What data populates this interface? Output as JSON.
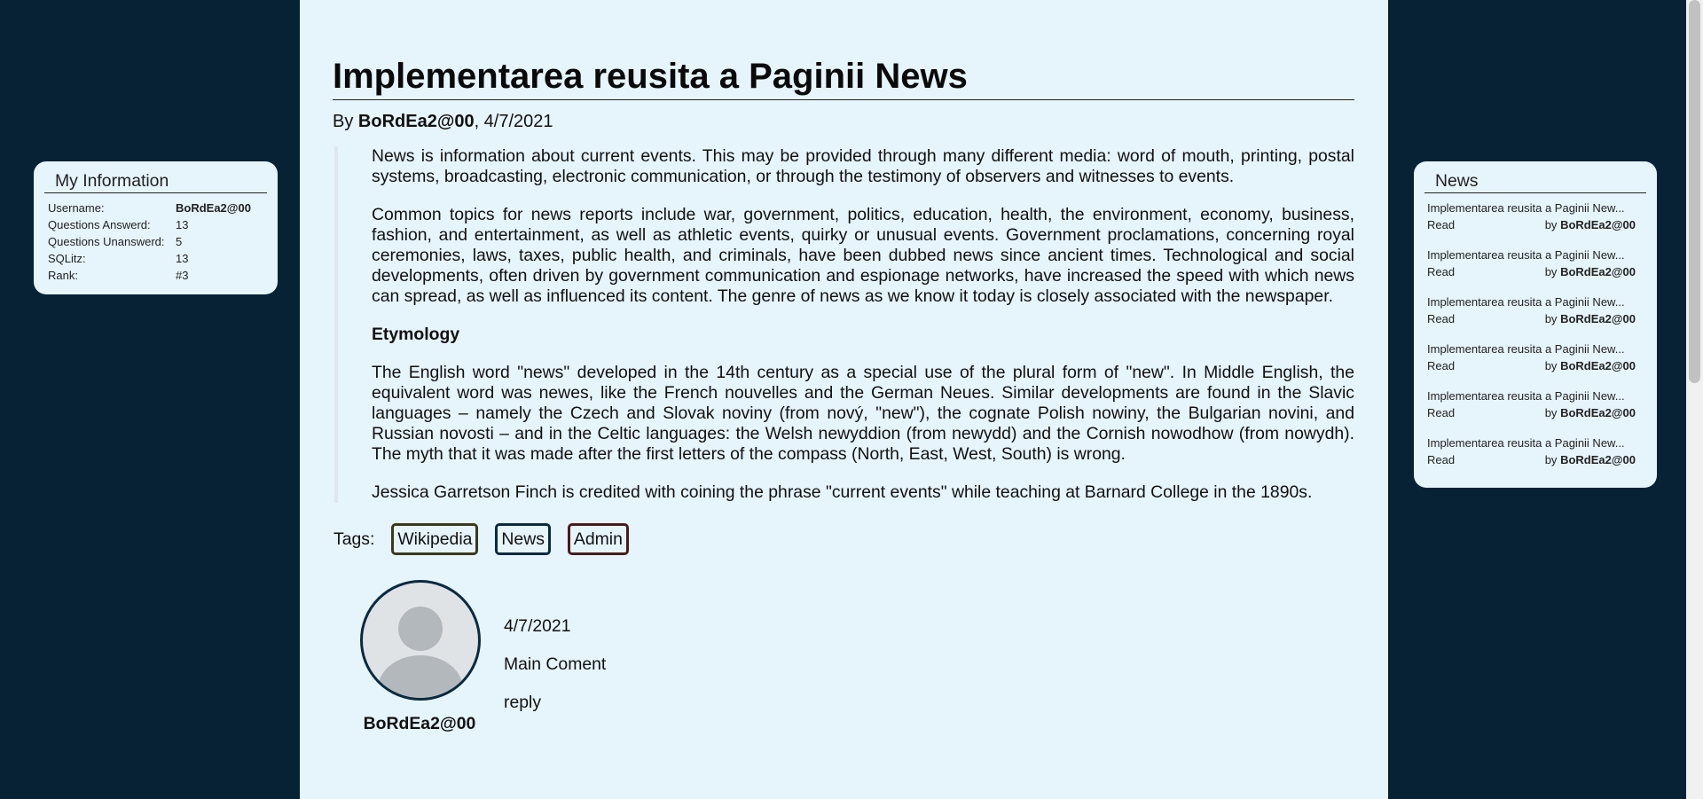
{
  "article": {
    "title": "Implementarea reusita a Paginii News",
    "by_prefix": "By",
    "author": "BoRdEa2@00",
    "date_sep": ", 4/7/2021",
    "paragraphs": {
      "p1": "News is information about current events. This may be provided through many different media: word of mouth, printing, postal systems, broadcasting, electronic communication, or through the testimony of observers and witnesses to events.",
      "p2": "Common topics for news reports include war, government, politics, education, health, the environment, economy, business, fashion, and entertainment, as well as athletic events, quirky or unusual events. Government proclamations, concerning royal ceremonies, laws, taxes, public health, and criminals, have been dubbed news since ancient times. Technological and social developments, often driven by government communication and espionage networks, have increased the speed with which news can spread, as well as influenced its content. The genre of news as we know it today is closely associated with the newspaper.",
      "heading": "Etymology",
      "p3": "The English word \"news\" developed in the 14th century as a special use of the plural form of \"new\". In Middle English, the equivalent word was newes, like the French nouvelles and the German Neues. Similar developments are found in the Slavic languages – namely the Czech and Slovak noviny (from nový, \"new\"), the cognate Polish nowiny, the Bulgarian novini, and Russian novosti – and in the Celtic languages: the Welsh newyddion (from newydd) and the Cornish nowodhow (from nowydh). The myth that it was made after the first letters of the compass (North, East, West, South) is wrong.",
      "p4": "Jessica Garretson Finch is credited with coining the phrase \"current events\" while teaching at Barnard College in the 1890s."
    }
  },
  "tags": {
    "label": "Tags:",
    "items": [
      {
        "label": "Wikipedia",
        "color": "#3a3a1a"
      },
      {
        "label": "News",
        "color": "#0b2a3f"
      },
      {
        "label": "Admin",
        "color": "#4a1a1a"
      }
    ]
  },
  "comment": {
    "author": "BoRdEa2@00",
    "date": "4/7/2021",
    "text": "Main Coment",
    "reply_label": "reply",
    "avatar_icon": "user-avatar-icon"
  },
  "info": {
    "title": "My Information",
    "rows": [
      {
        "key": "Username:",
        "value": "BoRdEa2@00"
      },
      {
        "key": "Questions Answerd:",
        "value": "13"
      },
      {
        "key": "Questions Unanswerd:",
        "value": "5"
      },
      {
        "key": "SQLitz:",
        "value": "13"
      },
      {
        "key": "Rank:",
        "value": "#3"
      }
    ]
  },
  "news": {
    "title": "News",
    "items": [
      {
        "title": "Implementarea reusita a Paginii New...",
        "read": "Read",
        "by": "by",
        "author": "BoRdEa2@00"
      },
      {
        "title": "Implementarea reusita a Paginii New...",
        "read": "Read",
        "by": "by",
        "author": "BoRdEa2@00"
      },
      {
        "title": "Implementarea reusita a Paginii New...",
        "read": "Read",
        "by": "by",
        "author": "BoRdEa2@00"
      },
      {
        "title": "Implementarea reusita a Paginii New...",
        "read": "Read",
        "by": "by",
        "author": "BoRdEa2@00"
      },
      {
        "title": "Implementarea reusita a Paginii New...",
        "read": "Read",
        "by": "by",
        "author": "BoRdEa2@00"
      },
      {
        "title": "Implementarea reusita a Paginii New...",
        "read": "Read",
        "by": "by",
        "author": "BoRdEa2@00"
      }
    ]
  },
  "colors": {
    "background": "#072135",
    "panel": "#e6f4fc",
    "text": "#111111"
  }
}
